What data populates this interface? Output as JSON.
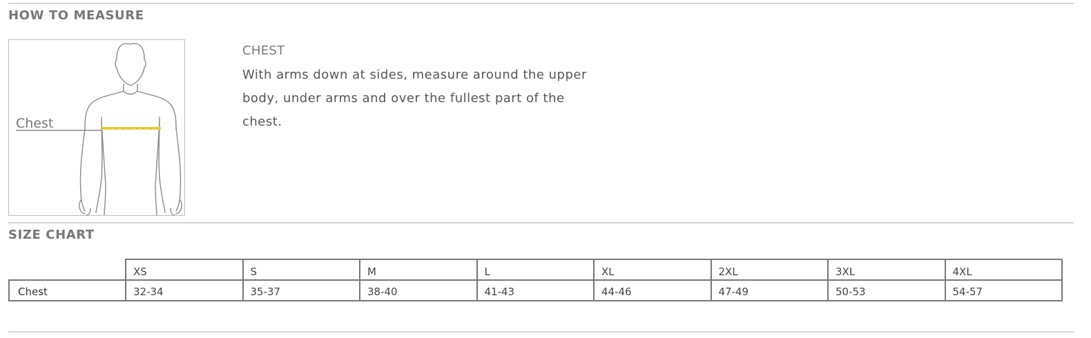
{
  "how_to_measure": {
    "title": "HOW TO MEASURE",
    "figure_label": "Chest",
    "measure_heading": "CHEST",
    "measure_text": "With arms down at sides, measure around the upper body, under arms and over the fullest part of the chest."
  },
  "size_chart": {
    "title": "SIZE CHART",
    "columns": [
      "XS",
      "S",
      "M",
      "L",
      "XL",
      "2XL",
      "3XL",
      "4XL"
    ],
    "rows": [
      {
        "label": "Chest",
        "values": [
          "32-34",
          "35-37",
          "38-40",
          "41-43",
          "44-46",
          "47-49",
          "50-53",
          "54-57"
        ]
      }
    ]
  },
  "colors": {
    "chest_line": "#e8d23a",
    "rule": "#d4d4d4",
    "table_border": "#777777"
  }
}
